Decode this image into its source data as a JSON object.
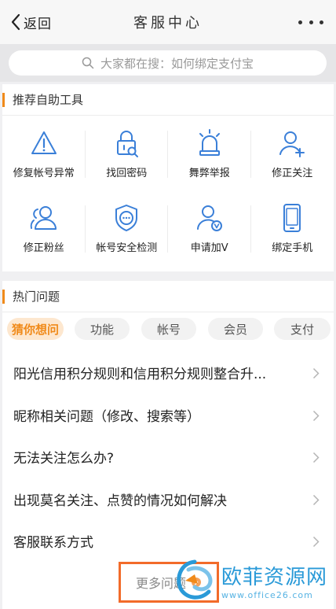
{
  "navbar": {
    "back_label": "返回",
    "title": "客服中心"
  },
  "search": {
    "placeholder": "大家都在搜：如何绑定支付宝"
  },
  "tools": {
    "heading": "推荐自助工具",
    "items": [
      {
        "label": "修复帐号异常",
        "icon": "warning-triangle-icon"
      },
      {
        "label": "找回密码",
        "icon": "lock-search-icon"
      },
      {
        "label": "舞弊举报",
        "icon": "alarm-light-icon"
      },
      {
        "label": "修正关注",
        "icon": "user-add-icon"
      },
      {
        "label": "修正粉丝",
        "icon": "users-icon"
      },
      {
        "label": "帐号安全检测",
        "icon": "shield-icon"
      },
      {
        "label": "申请加V",
        "icon": "user-verified-icon"
      },
      {
        "label": "绑定手机",
        "icon": "phone-icon"
      }
    ]
  },
  "hot": {
    "heading": "热门问题",
    "tabs": [
      {
        "label": "猜你想问",
        "active": true
      },
      {
        "label": "功能",
        "active": false
      },
      {
        "label": "帐号",
        "active": false
      },
      {
        "label": "会员",
        "active": false
      },
      {
        "label": "支付",
        "active": false
      }
    ],
    "questions": [
      "阳光信用积分规则和信用积分规则整合升...",
      "昵称相关问题（修改、搜索等）",
      "无法关注怎么办?",
      "出现莫名关注、点赞的情况如何解决",
      "客服联系方式"
    ],
    "more_label": "更多问题"
  },
  "watermark": {
    "title": "欧菲资源网",
    "url": "www.office26.com"
  },
  "colors": {
    "accent": "#f08a1a",
    "icon_blue": "#3a7fd8",
    "highlight_box": "#f26b2a"
  }
}
